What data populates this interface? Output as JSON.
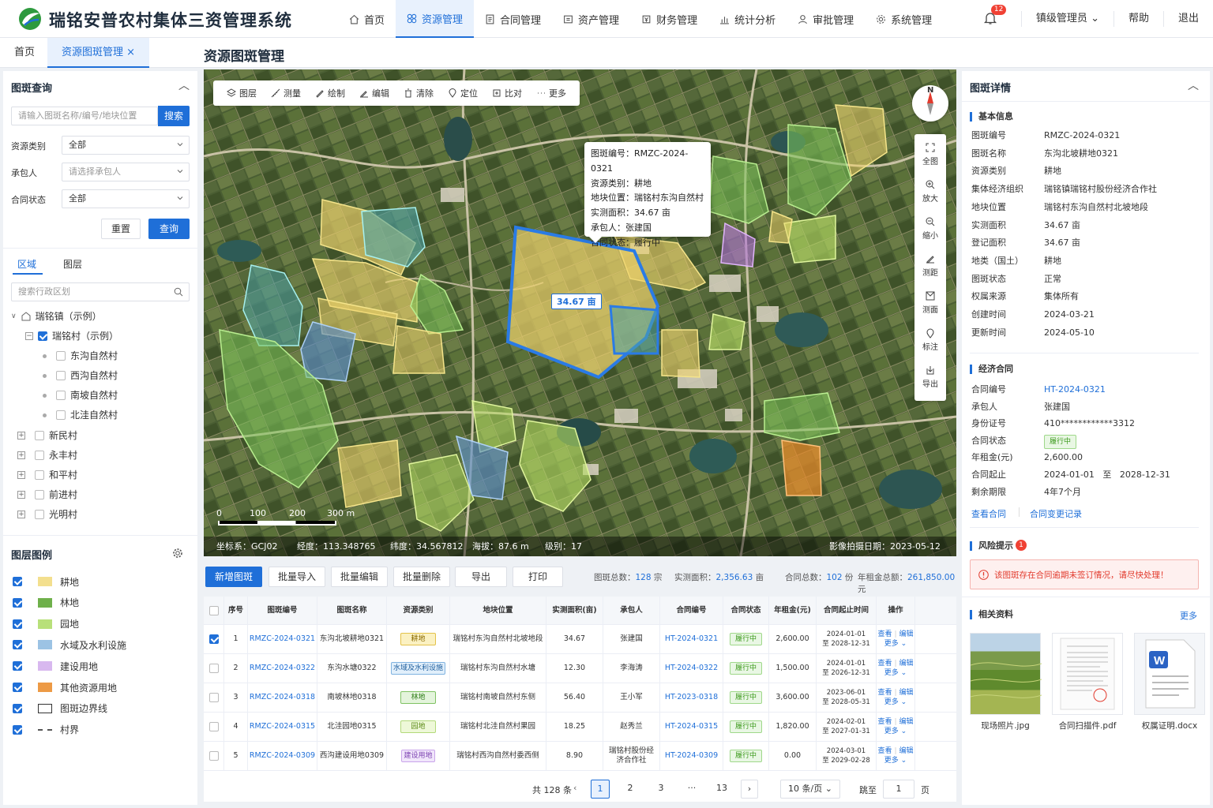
{
  "app": {
    "title": "瑞铭安普农村集体三资管理系统"
  },
  "nav": [
    {
      "label": "首页",
      "icon": "home-icon"
    },
    {
      "label": "资源管理",
      "icon": "resource-icon"
    },
    {
      "label": "合同管理",
      "icon": "contract-icon"
    },
    {
      "label": "资产管理",
      "icon": "asset-icon"
    },
    {
      "label": "财务管理",
      "icon": "finance-icon"
    },
    {
      "label": "统计分析",
      "icon": "chart-icon"
    },
    {
      "label": "审批管理",
      "icon": "approval-icon"
    },
    {
      "label": "系统管理",
      "icon": "settings-icon"
    }
  ],
  "header": {
    "notifications": "12",
    "user": "镇级管理员",
    "help": "帮助",
    "logout": "退出"
  },
  "tabs": {
    "home": "首页",
    "current": "资源图斑管理",
    "close": "×"
  },
  "page_title": "资源图斑管理",
  "query": {
    "title": "图斑查询",
    "search_placeholder": "请输入图斑名称/编号/地块位置",
    "search_button": "搜索",
    "resource_type_label": "资源类别",
    "resource_type_value": "全部",
    "contractor_label": "承包人",
    "contractor_placeholder": "请选择承包人",
    "contract_status_label": "合同状态",
    "contract_status_value": "全部",
    "reset": "重置",
    "submit": "查询"
  },
  "region": {
    "tab_region": "区域",
    "tab_layer": "图层",
    "search_placeholder": "搜索行政区划",
    "town": "瑞铭镇（示例）",
    "village": "瑞铭村（示例）",
    "hamlets": [
      "东沟自然村",
      "西沟自然村",
      "南坡自然村",
      "北洼自然村"
    ],
    "villages": [
      "新民村",
      "永丰村",
      "和平村",
      "前进村",
      "光明村"
    ]
  },
  "legend": {
    "title": "图层图例",
    "items": [
      {
        "label": "耕地",
        "color": "#f3df8e"
      },
      {
        "label": "林地",
        "color": "#6fb04b"
      },
      {
        "label": "园地",
        "color": "#b8e07a"
      },
      {
        "label": "水域及水利设施",
        "color": "#9cc3e4"
      },
      {
        "label": "建设用地",
        "color": "#d8b8ef"
      },
      {
        "label": "其他资源用地",
        "color": "#ed9a45"
      },
      {
        "label": "图斑边界线",
        "color": "#ffffff"
      },
      {
        "label": "村界",
        "color": "#ffffff"
      }
    ]
  },
  "map": {
    "toolbar": [
      "图层",
      "测量",
      "绘制",
      "编辑",
      "清除",
      "定位",
      "比对",
      "更多"
    ],
    "compass": "N",
    "side_tools": [
      "全图",
      "放大",
      "缩小",
      "测距",
      "测面",
      "标注",
      "导出"
    ],
    "popup": {
      "code": "图斑编号：RMZC-2024-0321",
      "type": "资源类别：耕地",
      "location": "地块位置：瑞铭村东沟自然村",
      "area": "实测面积：34.67 亩",
      "contractor": "承包人：张建国",
      "status": "合同状态：履行中"
    },
    "area_label": "34.67 亩",
    "scale": [
      "0",
      "100",
      "200",
      "300 m"
    ],
    "status": {
      "crs": "坐标系：GCJ02",
      "lng": "经度：113.348765",
      "lat": "纬度：34.567812",
      "alt": "海拔：87.6 m",
      "level": "级别：17",
      "date": "影像拍摄日期：2023-05-12"
    }
  },
  "actions": {
    "add": "新增图斑",
    "import": "批量导入",
    "batch_edit": "批量编辑",
    "batch_delete": "批量删除",
    "export": "导出",
    "print": "打印"
  },
  "stats": {
    "total_label": "图斑总数：",
    "total": "128",
    "total_unit": "宗",
    "area_label": "实测面积：",
    "area": "2,356.63",
    "area_unit": "亩",
    "contracts_label": "合同总数：",
    "contracts": "102",
    "contracts_unit": "份",
    "rent_label": "年租金总额：",
    "rent": "261,850.00",
    "rent_unit": "元"
  },
  "table": {
    "headers": [
      "序号",
      "图斑编号",
      "图斑名称",
      "资源类别",
      "地块位置",
      "实测面积(亩)",
      "承包人",
      "合同编号",
      "合同状态",
      "年租金(元)",
      "合同起止时间",
      "操作"
    ],
    "rows": [
      {
        "no": "1",
        "code": "RMZC-2024-0321",
        "name": "东沟北坡耕地0321",
        "type": "耕地",
        "type_bg": "#fbf1c2",
        "type_border": "#e3c24a",
        "type_color": "#8a6a00",
        "loc": "瑞铭村东沟自然村北坡地段",
        "area": "34.67",
        "person": "张建国",
        "contract": "HT-2024-0321",
        "status": "履行中",
        "rent": "2,600.00",
        "start": "2024-01-01",
        "end": "至 2028-12-31",
        "checked": true
      },
      {
        "no": "2",
        "code": "RMZC-2024-0322",
        "name": "东沟水塘0322",
        "type": "水域及水利设施",
        "type_bg": "#e1effb",
        "type_border": "#7fb2e0",
        "type_color": "#1f5f9e",
        "loc": "瑞铭村东沟自然村水塘",
        "area": "12.30",
        "person": "李海涛",
        "contract": "HT-2024-0322",
        "status": "履行中",
        "rent": "1,500.00",
        "start": "2024-01-01",
        "end": "至 2026-12-31",
        "checked": false
      },
      {
        "no": "3",
        "code": "RMZC-2024-0318",
        "name": "南坡林地0318",
        "type": "林地",
        "type_bg": "#e4f4dc",
        "type_border": "#7fc263",
        "type_color": "#2f7d18",
        "loc": "瑞铭村南坡自然村东侧",
        "area": "56.40",
        "person": "王小军",
        "contract": "HT-2023-0318",
        "status": "履行中",
        "rent": "3,600.00",
        "start": "2023-06-01",
        "end": "至 2028-05-31",
        "checked": false
      },
      {
        "no": "4",
        "code": "RMZC-2024-0315",
        "name": "北洼园地0315",
        "type": "园地",
        "type_bg": "#eef8d8",
        "type_border": "#b2d97a",
        "type_color": "#5a8a14",
        "loc": "瑞铭村北洼自然村果园",
        "area": "18.25",
        "person": "赵秀兰",
        "contract": "HT-2024-0315",
        "status": "履行中",
        "rent": "1,820.00",
        "start": "2024-02-01",
        "end": "至 2027-01-31",
        "checked": false
      },
      {
        "no": "5",
        "code": "RMZC-2024-0309",
        "name": "西沟建设用地0309",
        "type": "建设用地",
        "type_bg": "#f1e6fb",
        "type_border": "#c9a4ea",
        "type_color": "#7a3fb0",
        "loc": "瑞铭村西沟自然村委西侧",
        "area": "8.90",
        "person": "瑞铭村股份经济合作社",
        "contract": "HT-2024-0309",
        "status": "履行中",
        "rent": "0.00",
        "start": "2024-03-01",
        "end": "至 2029-02-28",
        "checked": false
      }
    ],
    "op_view": "查看",
    "op_edit": "编辑",
    "op_more": "更多"
  },
  "pager": {
    "total": "共 128 条",
    "pages": [
      "1",
      "2",
      "3",
      "···",
      "13"
    ],
    "page_size": "10 条/页",
    "jump_label": "跳至",
    "jump_value": "1",
    "jump_unit": "页"
  },
  "detail": {
    "title": "图斑详情",
    "basic_title": "基本信息",
    "basic": [
      {
        "k": "图斑编号",
        "v": "RMZC-2024-0321"
      },
      {
        "k": "图斑名称",
        "v": "东沟北坡耕地0321"
      },
      {
        "k": "资源类别",
        "v": "耕地"
      },
      {
        "k": "集体经济组织",
        "v": "瑞铭镇瑞铭村股份经济合作社"
      },
      {
        "k": "地块位置",
        "v": "瑞铭村东沟自然村北坡地段"
      },
      {
        "k": "实测面积",
        "v": "34.67 亩"
      },
      {
        "k": "登记面积",
        "v": "34.67 亩"
      },
      {
        "k": "地类（国土）",
        "v": "耕地"
      },
      {
        "k": "图斑状态",
        "v": "正常"
      },
      {
        "k": "权属来源",
        "v": "集体所有"
      },
      {
        "k": "创建时间",
        "v": "2024-03-21"
      },
      {
        "k": "更新时间",
        "v": "2024-05-10"
      }
    ],
    "contract_title": "经济合同",
    "contract": [
      {
        "k": "合同编号",
        "v": "HT-2024-0321"
      },
      {
        "k": "承包人",
        "v": "张建国"
      },
      {
        "k": "身份证号",
        "v": "410************3312"
      },
      {
        "k": "合同状态",
        "v": "履行中"
      },
      {
        "k": "年租金(元)",
        "v": "2,600.00"
      },
      {
        "k": "合同起止",
        "v": "2024-01-01   至   2028-12-31"
      },
      {
        "k": "剩余期限",
        "v": "4年7个月"
      }
    ],
    "view_contract": "查看合同",
    "change_log": "合同变更记录",
    "risk_title": "风险提示",
    "risk_count": "1",
    "risk_text": "该图斑存在合同逾期未签订情况，请尽快处理！",
    "files_title": "相关资料",
    "files_more": "更多",
    "files": [
      "现场照片.jpg",
      "合同扫描件.pdf",
      "权属证明.docx"
    ]
  }
}
